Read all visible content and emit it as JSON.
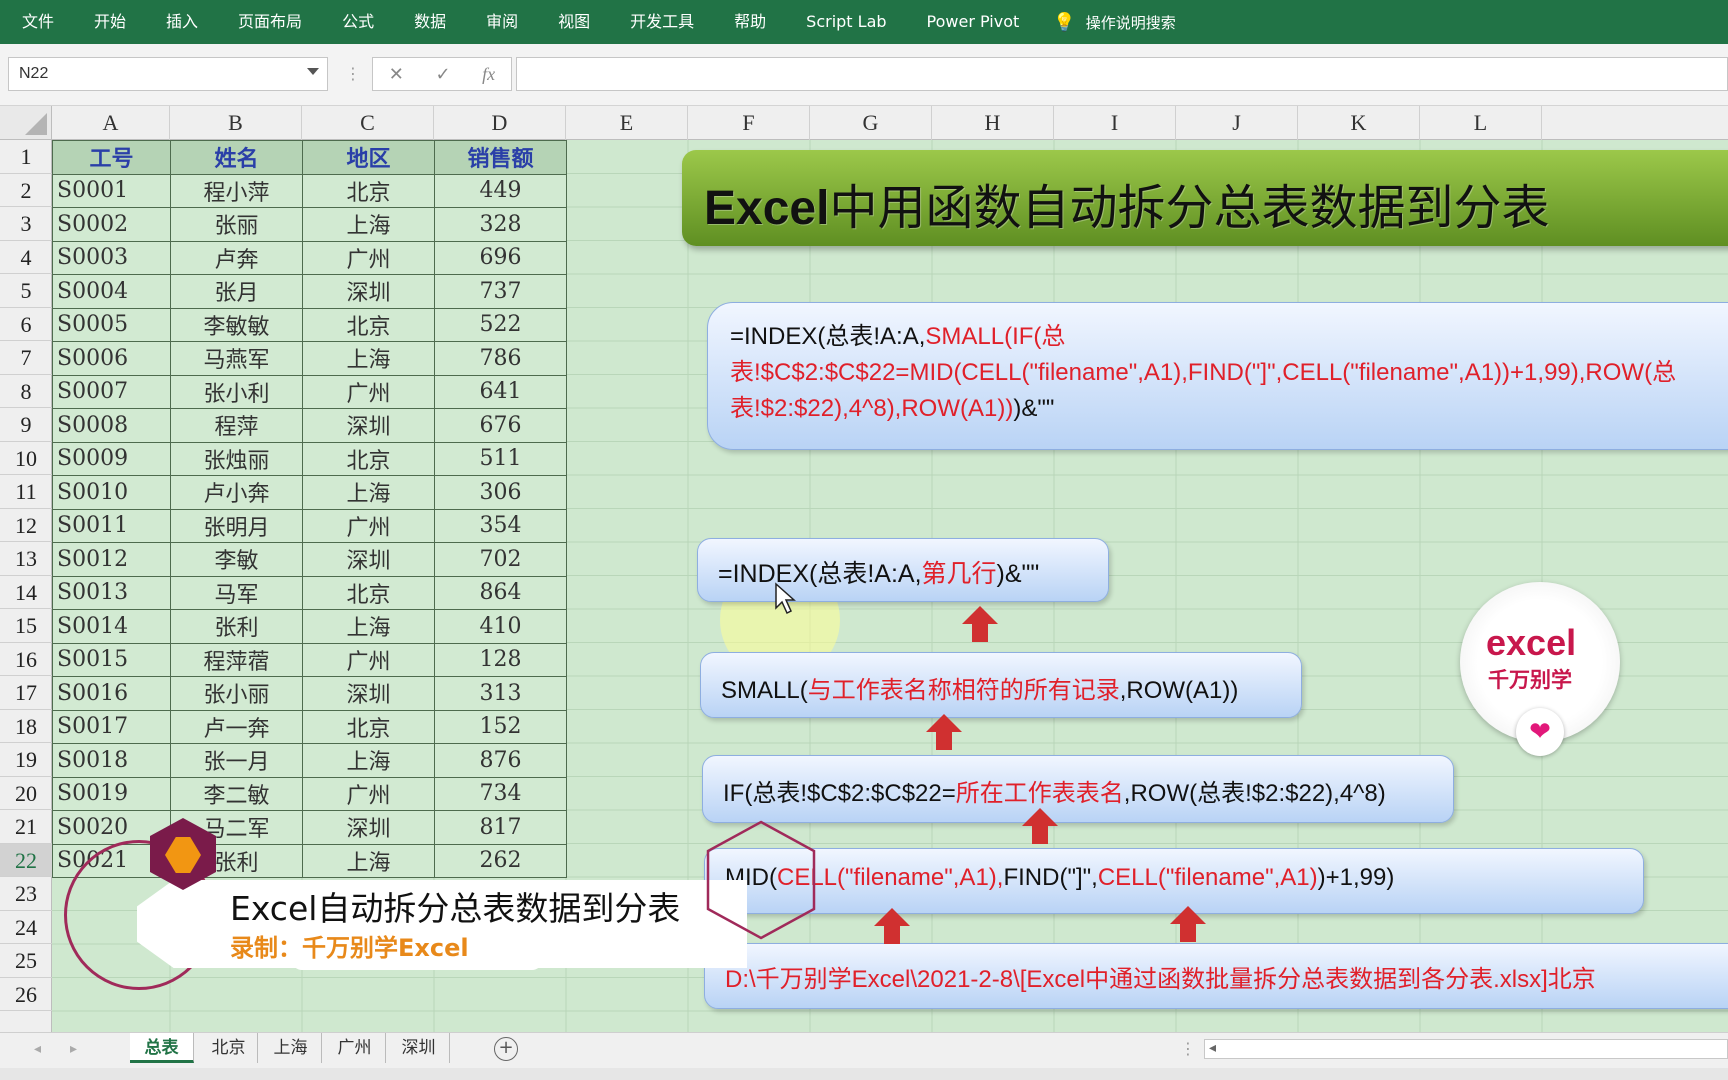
{
  "ribbon": {
    "tabs": [
      "文件",
      "开始",
      "插入",
      "页面布局",
      "公式",
      "数据",
      "审阅",
      "视图",
      "开发工具",
      "帮助",
      "Script Lab",
      "Power Pivot"
    ],
    "tell_me": "操作说明搜索"
  },
  "formula_bar": {
    "name_box": "N22",
    "fx": "fx",
    "formula": ""
  },
  "columns": [
    "A",
    "B",
    "C",
    "D",
    "E",
    "F",
    "G",
    "H",
    "I",
    "J",
    "K",
    "L"
  ],
  "rows": [
    "1",
    "2",
    "3",
    "4",
    "5",
    "6",
    "7",
    "8",
    "9",
    "10",
    "11",
    "12",
    "13",
    "14",
    "15",
    "16",
    "17",
    "18",
    "19",
    "20",
    "21",
    "22",
    "23",
    "24",
    "25",
    "26"
  ],
  "selected_row": "22",
  "table": {
    "headers": [
      "工号",
      "姓名",
      "地区",
      "销售额"
    ],
    "rows": [
      [
        "S0001",
        "程小萍",
        "北京",
        "449"
      ],
      [
        "S0002",
        "张丽",
        "上海",
        "328"
      ],
      [
        "S0003",
        "卢奔",
        "广州",
        "696"
      ],
      [
        "S0004",
        "张月",
        "深圳",
        "737"
      ],
      [
        "S0005",
        "李敏敏",
        "北京",
        "522"
      ],
      [
        "S0006",
        "马燕军",
        "上海",
        "786"
      ],
      [
        "S0007",
        "张小利",
        "广州",
        "641"
      ],
      [
        "S0008",
        "程萍",
        "深圳",
        "676"
      ],
      [
        "S0009",
        "张烛丽",
        "北京",
        "511"
      ],
      [
        "S0010",
        "卢小奔",
        "上海",
        "306"
      ],
      [
        "S0011",
        "张明月",
        "广州",
        "354"
      ],
      [
        "S0012",
        "李敏",
        "深圳",
        "702"
      ],
      [
        "S0013",
        "马军",
        "北京",
        "864"
      ],
      [
        "S0014",
        "张利",
        "上海",
        "410"
      ],
      [
        "S0015",
        "程萍蓿",
        "广州",
        "128"
      ],
      [
        "S0016",
        "张小丽",
        "深圳",
        "313"
      ],
      [
        "S0017",
        "卢一奔",
        "北京",
        "152"
      ],
      [
        "S0018",
        "张一月",
        "上海",
        "876"
      ],
      [
        "S0019",
        "李二敏",
        "广州",
        "734"
      ],
      [
        "S0020",
        "马二军",
        "深圳",
        "817"
      ],
      [
        "S0021",
        "张利",
        "上海",
        "262"
      ]
    ]
  },
  "banner": {
    "title_a": "Excel",
    "title_b": "中用函数自动拆分总表数据到分表"
  },
  "boxes": {
    "big": {
      "p1": "=INDEX(总表!A:A,",
      "p2": "SMALL(IF(总表!$C$2:$C$22=MID(CELL(\"filename\",A1),FIND(\"]\",CELL(\"filename\",A1))+1,99),ROW(总表!$2:$22),4^8),ROW(A1))",
      "p3": ")&\"\""
    },
    "index": {
      "p1": "=INDEX(总表!A:A,",
      "p2": "第几行",
      "p3": ")&\"\""
    },
    "small": {
      "p1": "SMALL(",
      "p2": "与工作表名称相符的所有记录",
      "p3": ",ROW(A1))"
    },
    "if": {
      "p1": "IF(总表!$C$2:$C$22=",
      "p2": "所在工作表表名",
      "p3": ",ROW(总表!$2:$22),4^8)"
    },
    "mid": {
      "p1": "MID(",
      "p2": "CELL(\"filename\",A1),",
      "p3": "FIND(\"]\",",
      "p4": "CELL(\"filename\",A1)",
      "p5": ")+1,99)"
    },
    "path": "D:\\千万别学Excel\\2021-2-8\\[Excel中通过函数批量拆分总表数据到各分表.xlsx]北京"
  },
  "logo": {
    "line1": "excel",
    "line2": "千万别学",
    "heart": "❤"
  },
  "watermark": {
    "title": "Excel自动拆分总表数据到分表",
    "subtitle": "录制：千万别学Excel"
  },
  "sheet_tabs": [
    "总表",
    "北京",
    "上海",
    "广州",
    "深圳"
  ],
  "active_sheet": "总表",
  "add_sheet": "+",
  "colors": {
    "ribbon": "#217346",
    "sheet_bg": "#cfe8cf",
    "header_text": "#2a3fa8",
    "formula_red": "#e0202a",
    "banner": "#7fae35"
  }
}
